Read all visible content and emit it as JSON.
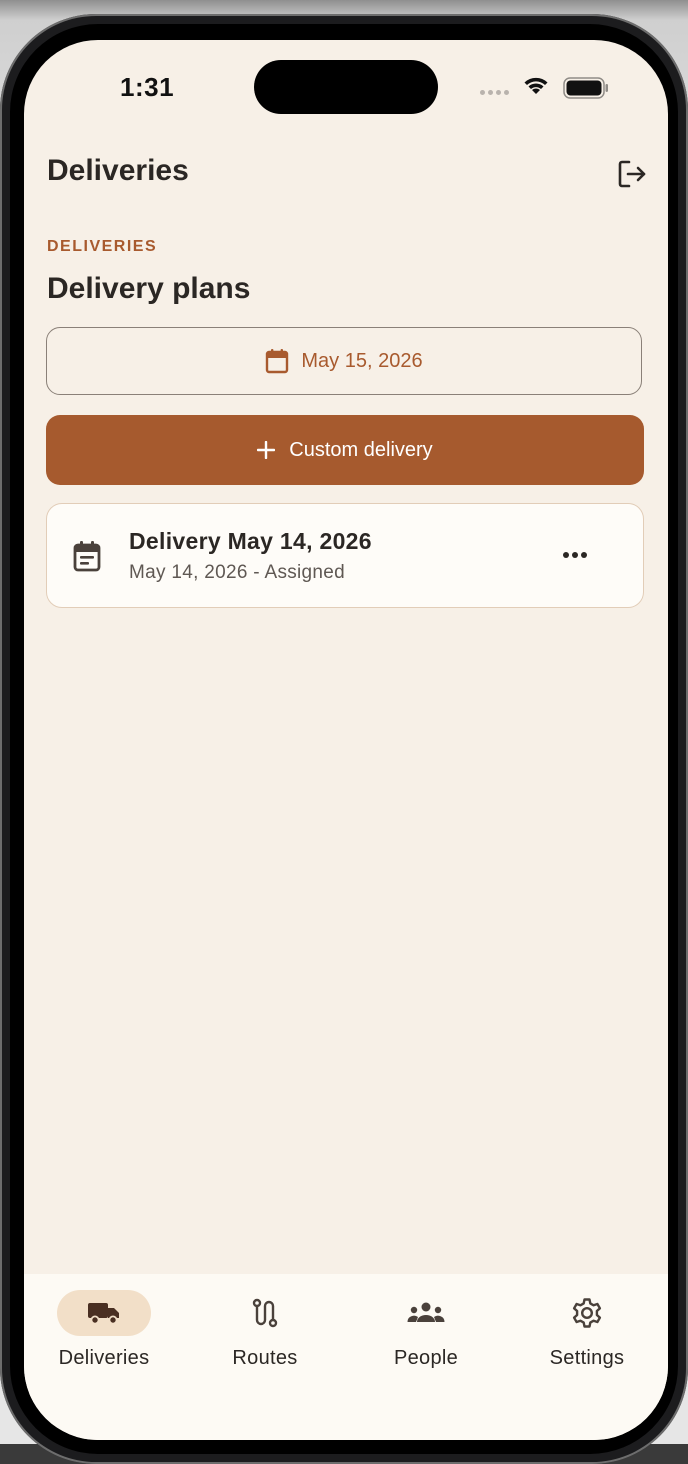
{
  "status_bar": {
    "time": "1:31"
  },
  "header": {
    "title": "Deliveries",
    "logout_icon": "logout-icon"
  },
  "section": {
    "eyebrow": "DELIVERIES",
    "title": "Delivery plans"
  },
  "date_picker": {
    "icon": "calendar-icon",
    "value": "May 15, 2026"
  },
  "custom_delivery_button": {
    "icon": "plus-icon",
    "label": "Custom delivery"
  },
  "delivery_list": [
    {
      "icon": "event-note-icon",
      "title": "Delivery May 14, 2026",
      "subtitle": "May 14, 2026 - Assigned",
      "menu_icon": "more-horizontal-icon"
    }
  ],
  "bottom_nav": {
    "items": [
      {
        "label": "Deliveries",
        "icon": "truck-icon",
        "active": true
      },
      {
        "label": "Routes",
        "icon": "route-icon",
        "active": false
      },
      {
        "label": "People",
        "icon": "people-icon",
        "active": false
      },
      {
        "label": "Settings",
        "icon": "gear-icon",
        "active": false
      }
    ]
  },
  "colors": {
    "accent": "#a65a2e",
    "background": "#f7f0e7",
    "card": "#fefcf8",
    "nav_active_pill": "#f2dfc8"
  }
}
